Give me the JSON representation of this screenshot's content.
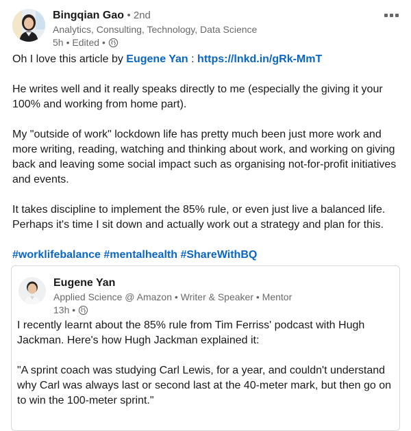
{
  "post": {
    "author": {
      "name": "Bingqian Gao",
      "degree": "• 2nd",
      "headline": "Analytics, Consulting, Technology, Data Science",
      "time": "5h",
      "edited": "• Edited •"
    },
    "body": {
      "p1_prefix": "Oh I love this article by ",
      "p1_mention": "Eugene Yan",
      "p1_sep": " : ",
      "p1_url": "https://lnkd.in/gRk-MmT",
      "p2": "He writes well and it really speaks directly to me (especially the giving it your 100% and working from home part).",
      "p3": "My \"outside of work\" lockdown life has pretty much been just more work and more writing, reading, watching and thinking about work, and working on giving back and leaving some social impact such as organising not-for-profit initiatives and events.",
      "p4": "It takes discipline to implement the 85% rule, or even just live a balanced life. Perhaps it's time I sit down and actually work out a strategy and plan for this.",
      "hashtags": [
        "#worklifebalance",
        "#mentalhealth",
        "#ShareWithBQ"
      ]
    }
  },
  "shared": {
    "author": {
      "name": "Eugene Yan",
      "headline": "Applied Science @ Amazon • Writer & Speaker • Mentor",
      "time": "13h •"
    },
    "p1": "I recently learnt about the 85% rule from Tim Ferriss' podcast with Hugh Jackman. Here's how Hugh Jackman explained it:",
    "p2": "\"A sprint coach was studying Carl Lewis, for a year, and couldn't understand why Carl was always last or second last at the 40-meter mark, but then go on to win the 100-meter sprint.\""
  },
  "colors": {
    "link": "#0a66c2",
    "muted": "rgba(0,0,0,0.6)",
    "border": "#d8d8d8"
  },
  "icons": {
    "visibility": "globe-icon",
    "menu": "more-options-icon"
  }
}
